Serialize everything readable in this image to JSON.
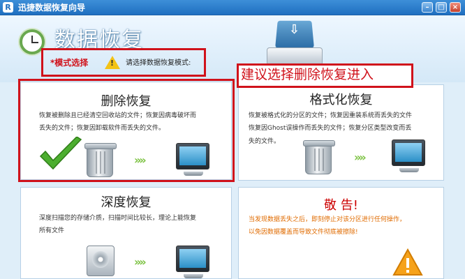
{
  "window": {
    "logo": "R",
    "title": "迅捷数据恢复向导",
    "buttons": [
      "–",
      "□",
      "×"
    ]
  },
  "header": {
    "heading": "数据恢复",
    "mode_label": "*模式选择",
    "mode_hint": "请选择数据恢复模式:",
    "warn_mark": "!"
  },
  "annotation": "建议选择删除恢复进入",
  "cards": {
    "delete": {
      "title": "删除恢复",
      "desc_line1": "恢复被删除且已经清空回收站的文件；恢复因病毒破坏而",
      "desc_line2": "丢失的文件；恢复因卸载软件而丢失的文件。"
    },
    "format": {
      "title": "格式化恢复",
      "desc_line1": "恢复被格式化的分区的文件；恢复因重装系统而丢失的文件",
      "desc_line2": "恢复因Ghost误操作而丢失的文件；恢复分区类型改变而丢",
      "desc_line3": "失的文件。"
    },
    "deep": {
      "title": "深度恢复",
      "desc_line1": "深度扫描您的存储介质，扫描时间比较长，理论上能恢复",
      "desc_line2": "所有文件"
    },
    "warning": {
      "title": "敬 告!",
      "desc_line1": "当发现数据丢失之后，即刻停止对该分区进行任何操作，",
      "desc_line2": "以免因数据覆盖而导致文件彻底被擦除!"
    }
  },
  "icons": {
    "arrows": "»»",
    "drive_arrow": "⇩"
  }
}
